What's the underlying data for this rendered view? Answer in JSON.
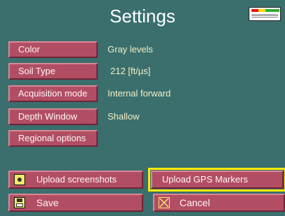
{
  "header": {
    "title": "Settings"
  },
  "settings": [
    {
      "label": "Color",
      "value": "Gray levels"
    },
    {
      "label": "Soil Type",
      "value": "212  [ft/µs]"
    },
    {
      "label": "Acquisition mode",
      "value": "Internal forward"
    },
    {
      "label": "Depth Window",
      "value": "Shallow"
    },
    {
      "label": "Regional options",
      "value": ""
    }
  ],
  "actions": {
    "upload_screenshots": "Upload screenshots",
    "upload_gps": "Upload GPS Markers",
    "save": "Save",
    "cancel": "Cancel"
  },
  "icons": {
    "battery": "battery-icon",
    "screenshot": "camera-icon",
    "save": "floppy-disk-icon",
    "cancel": "close-box-icon"
  },
  "colors": {
    "background": "#3a6f6e",
    "button": "#b24e64",
    "value_text": "#f3f0c4",
    "focus": "#ffeb00"
  }
}
